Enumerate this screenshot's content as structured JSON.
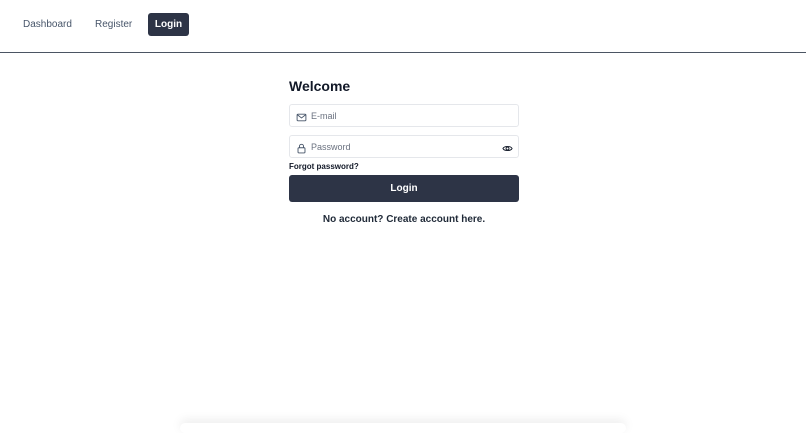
{
  "nav": {
    "items": [
      {
        "label": "Dashboard"
      },
      {
        "label": "Register"
      },
      {
        "label": "Login"
      }
    ]
  },
  "form": {
    "title": "Welcome",
    "email_placeholder": "E-mail",
    "email_value": "",
    "password_placeholder": "Password",
    "password_value": "",
    "forgot_label": "Forgot password?",
    "login_label": "Login",
    "no_account_label": "No account? Create account here."
  },
  "icons": {
    "email": "mail-icon",
    "password": "lock-icon",
    "toggle": "eye-icon"
  },
  "colors": {
    "primary": "#2d3446",
    "border": "#e5e7eb",
    "nav_text": "#475569",
    "placeholder": "#6b7280"
  }
}
